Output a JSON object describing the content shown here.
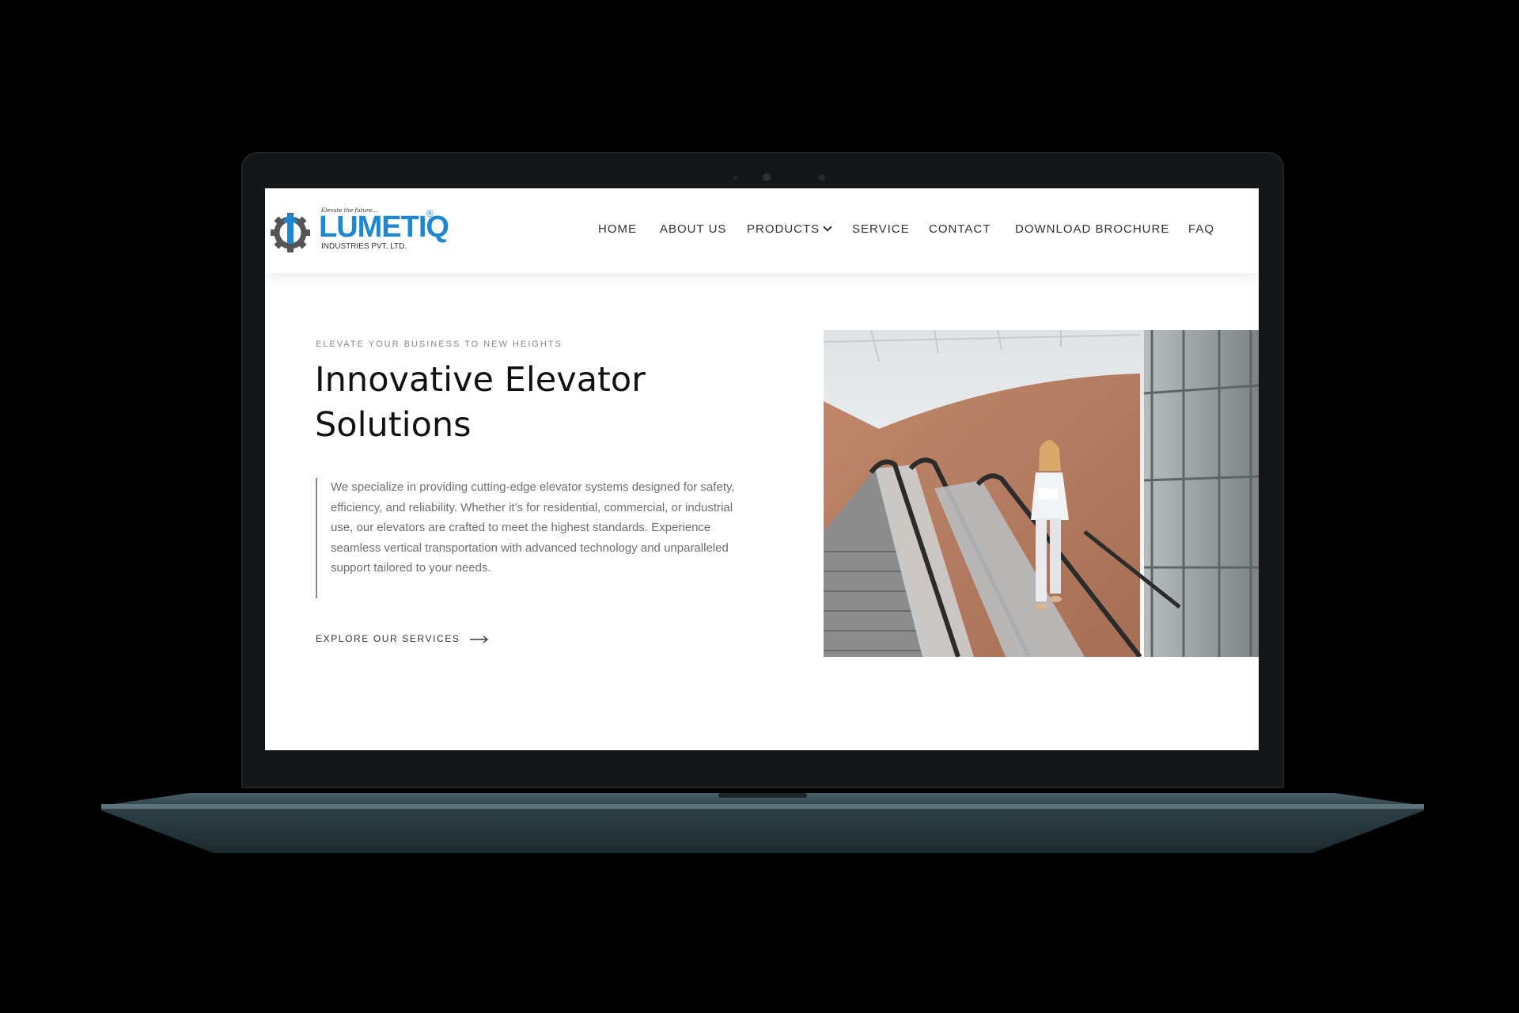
{
  "logo": {
    "tagline": "Elevate the future...",
    "name": "LUMETIQ",
    "registered": "®",
    "subtitle": "INDUSTRIES PVT. LTD."
  },
  "nav": {
    "items": [
      "HOME",
      "ABOUT US",
      "PRODUCTS",
      "SERVICE",
      "CONTACT",
      "DOWNLOAD BROCHURE",
      "FAQ"
    ]
  },
  "hero": {
    "eyebrow": "ELEVATE YOUR BUSINESS TO NEW HEIGHTS",
    "title_line1": "Innovative Elevator",
    "title_line2": "Solutions",
    "description": "We specialize in providing cutting-edge elevator systems designed for safety, efficiency, and reliability. Whether it's for residential, commercial, or industrial use, our elevators are crafted to meet the highest standards. Experience seamless vertical transportation with advanced technology and unparalleled support tailored to your needs.",
    "cta_label": "EXPLORE OUR SERVICES",
    "cta_icon": "arrow-right-icon",
    "image_subject": "escalator-photo"
  },
  "colors": {
    "brand_blue": "#1f86d1",
    "logo_gear": "#555555",
    "text_dark": "#111111",
    "text_muted": "#6e6e6e",
    "laptop_body": "#2c3d42",
    "bezel": "#141617"
  }
}
